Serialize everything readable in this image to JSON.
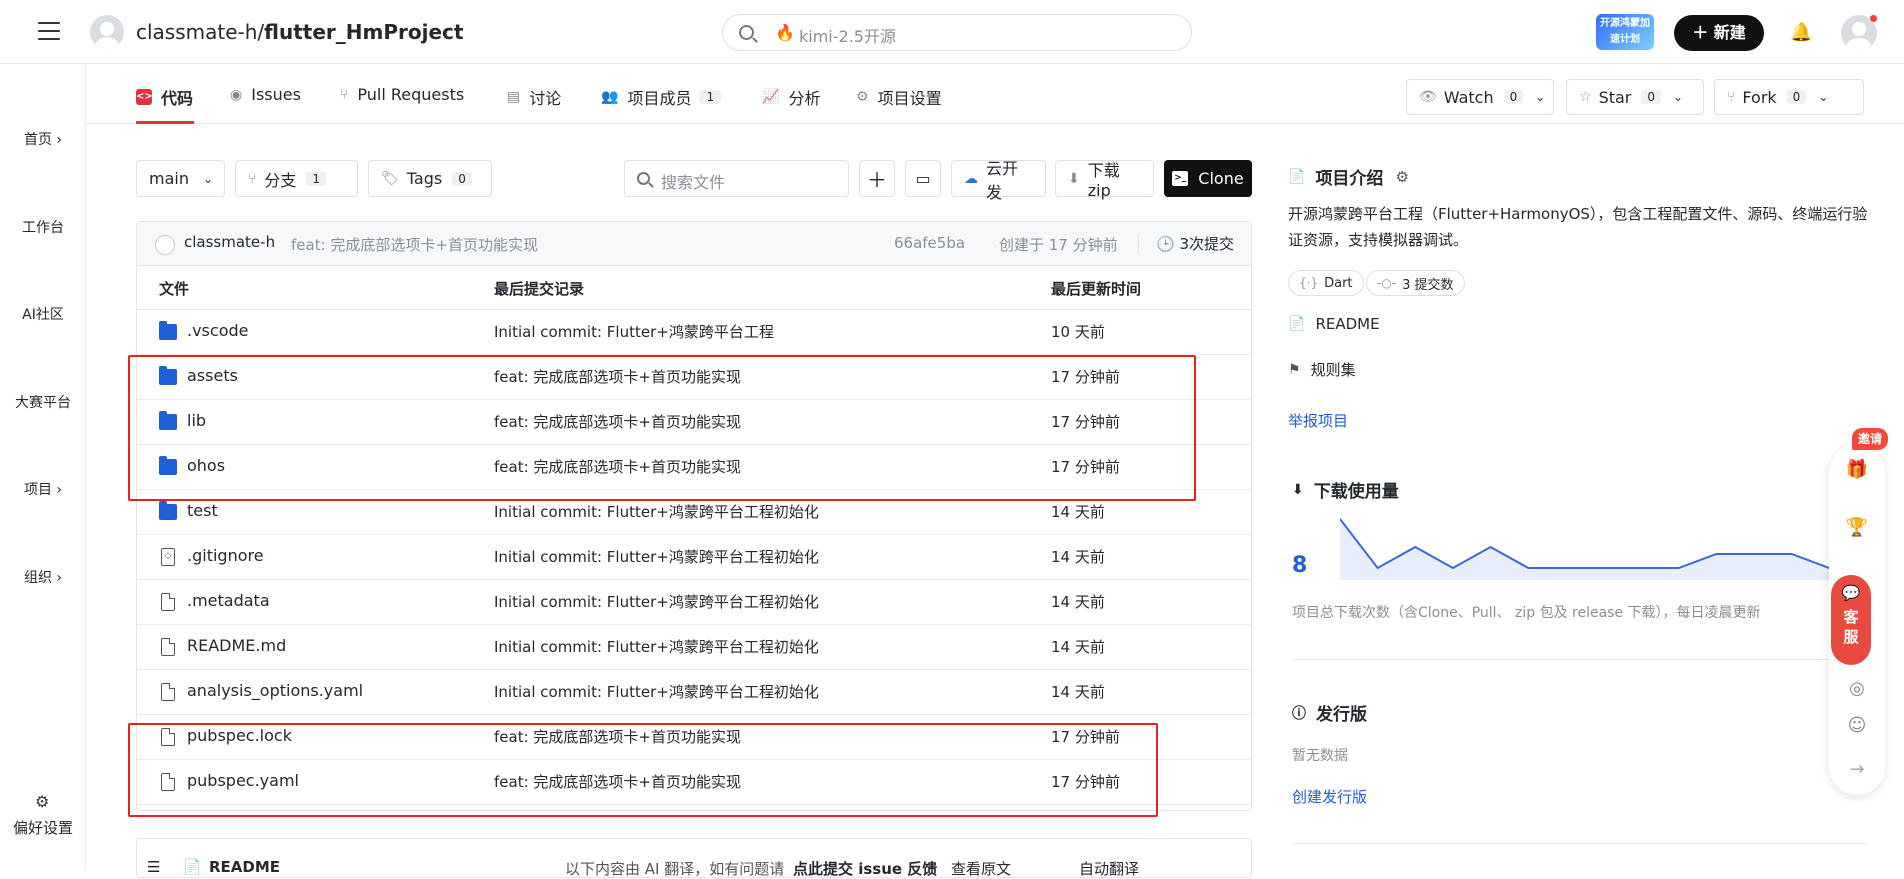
{
  "header": {
    "owner": "classmate-h/",
    "repo": "flutter_HmProject",
    "search_placeholder": "kimi-2.5开源",
    "promo": "开源鸿蒙加速计划",
    "new_label": "新建"
  },
  "leftnav": [
    "首页 ›",
    "工作台",
    "AI社区",
    "大赛平台",
    "项目 ›",
    "组织 ›"
  ],
  "leftnav_settings": "偏好设置",
  "tabs": [
    {
      "label": "代码"
    },
    {
      "label": "Issues"
    },
    {
      "label": "Pull Requests"
    },
    {
      "label": "讨论"
    },
    {
      "label": "项目成员",
      "count": "1"
    },
    {
      "label": "分析"
    },
    {
      "label": "项目设置"
    }
  ],
  "repo_actions": {
    "watch": "Watch",
    "watch_count": "0",
    "star": "Star",
    "star_count": "0",
    "fork": "Fork",
    "fork_count": "0"
  },
  "toolbar": {
    "branch": "main",
    "branches": "分支",
    "branches_count": "1",
    "tags": "Tags",
    "tags_count": "0",
    "search_placeholder": "搜索文件",
    "cloud": "云开发",
    "download": "下载zip",
    "clone": "Clone"
  },
  "last_commit": {
    "author": "classmate-h",
    "message": "feat: 完成底部选项卡+首页功能实现",
    "sha": "66afe5ba",
    "time": "创建于 17 分钟前",
    "commits": "3次提交"
  },
  "columns": [
    "文件",
    "最后提交记录",
    "最后更新时间"
  ],
  "files": [
    {
      "name": ".vscode",
      "type": "folder",
      "commit": "Initial commit: Flutter+鸿蒙跨平台工程",
      "time": "10 天前"
    },
    {
      "name": "assets",
      "type": "folder",
      "commit": "feat: 完成底部选项卡+首页功能实现",
      "time": "17 分钟前"
    },
    {
      "name": "lib",
      "type": "folder",
      "commit": "feat: 完成底部选项卡+首页功能实现",
      "time": "17 分钟前"
    },
    {
      "name": "ohos",
      "type": "folder",
      "commit": "feat: 完成底部选项卡+首页功能实现",
      "time": "17 分钟前"
    },
    {
      "name": "test",
      "type": "folder",
      "commit": "Initial commit: Flutter+鸿蒙跨平台工程初始化",
      "time": "14 天前"
    },
    {
      "name": ".gitignore",
      "type": "git",
      "commit": "Initial commit: Flutter+鸿蒙跨平台工程初始化",
      "time": "14 天前"
    },
    {
      "name": ".metadata",
      "type": "file",
      "commit": "Initial commit: Flutter+鸿蒙跨平台工程初始化",
      "time": "14 天前"
    },
    {
      "name": "README.md",
      "type": "file",
      "commit": "Initial commit: Flutter+鸿蒙跨平台工程初始化",
      "time": "14 天前"
    },
    {
      "name": "analysis_options.yaml",
      "type": "file",
      "commit": "Initial commit: Flutter+鸿蒙跨平台工程初始化",
      "time": "14 天前"
    },
    {
      "name": "pubspec.lock",
      "type": "file",
      "commit": "feat: 完成底部选项卡+首页功能实现",
      "time": "17 分钟前"
    },
    {
      "name": "pubspec.yaml",
      "type": "file",
      "commit": "feat: 完成底部选项卡+首页功能实现",
      "time": "17 分钟前"
    }
  ],
  "readme_bar": {
    "title": "README",
    "notice": "以下内容由 AI 翻译，如有问题请",
    "feedback": "点此提交 issue 反馈",
    "view_original": "查看原文",
    "auto_translate": "自动翻译"
  },
  "sidebar": {
    "intro_title": "项目介绍",
    "description": "开源鸿蒙跨平台工程（Flutter+HarmonyOS），包含工程配置文件、源码、终端运行验证资源，支持模拟器调试。",
    "language": "Dart",
    "commits_chip": "3 提交数",
    "readme": "README",
    "rules": "规则集",
    "report": "举报项目",
    "downloads_title": "下载使用量",
    "downloads_total": "8",
    "downloads_note": "项目总下载次数（含Clone、Pull、 zip 包及 release 下载），每日凌晨更新",
    "releases_title": "发行版",
    "no_data": "暂无数据",
    "create_release": "创建发行版"
  },
  "float_widget": {
    "invite": "邀请",
    "service": "客服"
  },
  "chart_data": {
    "type": "area",
    "values": [
      8,
      1,
      4,
      1,
      4,
      1,
      1,
      1,
      1,
      1,
      3,
      3,
      3,
      1,
      3
    ]
  }
}
